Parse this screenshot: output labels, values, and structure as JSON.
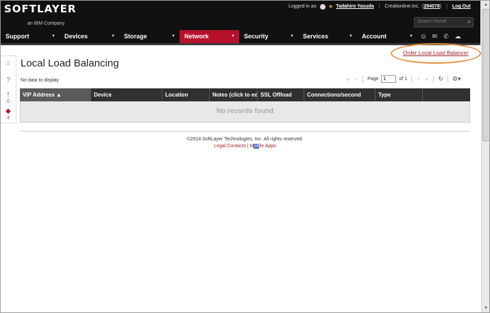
{
  "header": {
    "logo_text": "SOFTLAYER",
    "logo_sub": "an IBM Company",
    "logged_in_label": "Logged in as:",
    "user_name": "Tadahiro Yasuda",
    "company": "Creationline,Inc.",
    "account_id": "294078",
    "logout_label": "Log Out",
    "search_placeholder": "Search Portal"
  },
  "nav": {
    "items": [
      {
        "label": "Support"
      },
      {
        "label": "Devices"
      },
      {
        "label": "Storage"
      },
      {
        "label": "Network"
      },
      {
        "label": "Security"
      },
      {
        "label": "Services"
      },
      {
        "label": "Account"
      }
    ]
  },
  "sidebar": {
    "alerts_count": "0",
    "tags_count": "3"
  },
  "main": {
    "title": "Local Load Balancing",
    "order_link": "Order Local Load Balancer",
    "no_data": "No data to display",
    "pager": {
      "page_label": "Page",
      "page_value": "1",
      "of_label": "of 1"
    },
    "columns": [
      "VIP Address ▲",
      "Device",
      "Location",
      "Notes (click to edit)",
      "SSL Offload",
      "Connections/second",
      "Type",
      ""
    ],
    "empty_message": "No records found"
  },
  "footer": {
    "copyright": "©2014 SoftLayer Technologies, Inc. All rights reserved.",
    "legal": "Legal Contacts",
    "separator": "|",
    "mobile_pre": "M",
    "mobile_hl": "ob",
    "mobile_post": "ile Apps"
  },
  "colors": {
    "active_nav": "#b8102b",
    "link": "#a0232b",
    "highlight_oval": "#e3913f"
  }
}
